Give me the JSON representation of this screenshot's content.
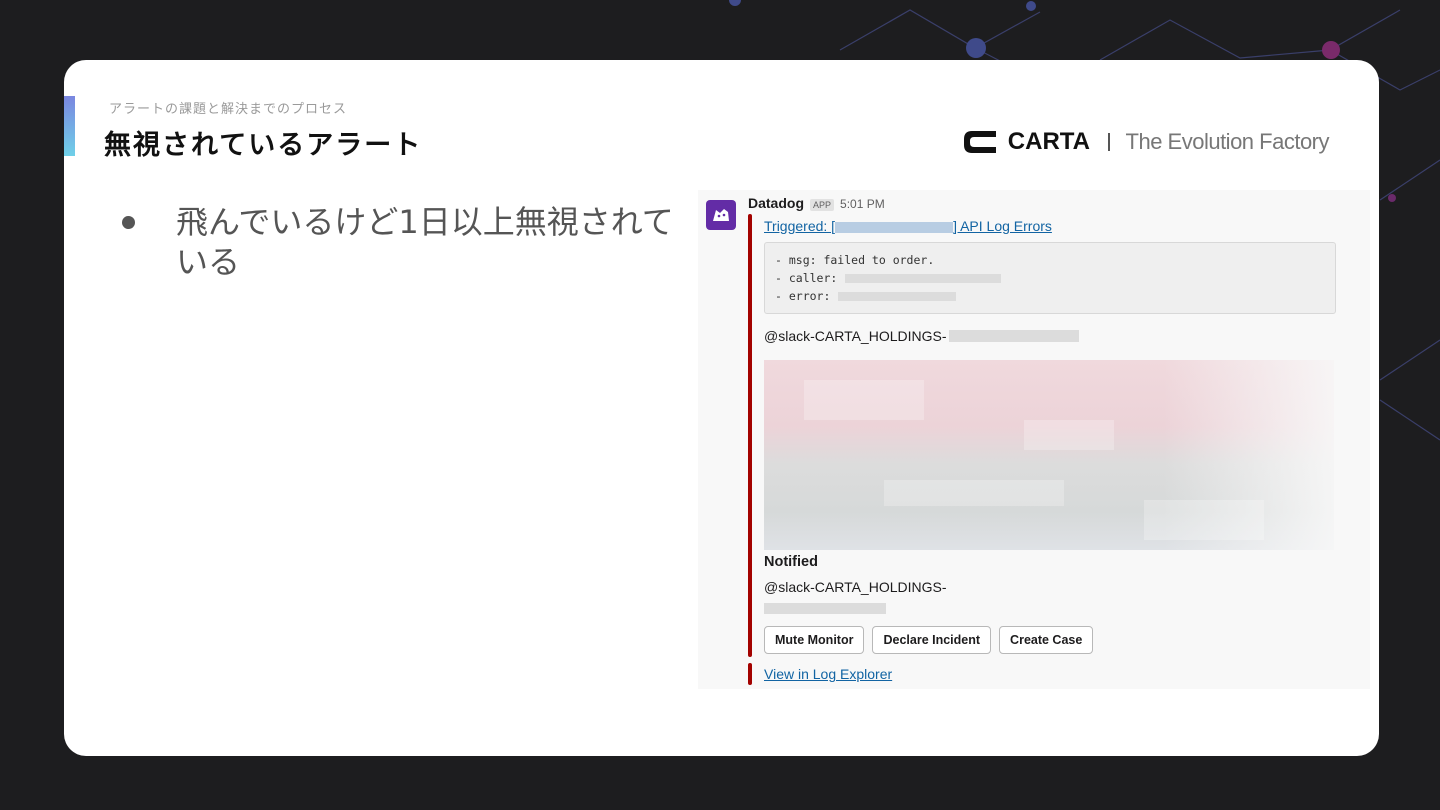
{
  "slide": {
    "eyebrow": "アラートの課題と解決までのプロセス",
    "title": "無視されているアラート",
    "brand_name": "CARTA",
    "brand_tagline": "The Evolution Factory",
    "bullets": [
      "飛んでいるけど1日以上無視されている"
    ],
    "accent_colors": {
      "bar_top": "#7a86e0",
      "bar_bottom": "#6fd0e8",
      "background": "#1d1d1f"
    }
  },
  "slack": {
    "sender": "Datadog",
    "app_badge": "APP",
    "time": "5:01 PM",
    "alert_prefix": "Triggered: [",
    "alert_suffix": "] API Log Errors",
    "code_lines": [
      "- msg: failed to order.",
      "- caller:",
      "- error:"
    ],
    "mention": "@slack-CARTA_HOLDINGS-",
    "notified_title": "Notified",
    "notified_mention": "@slack-CARTA_HOLDINGS-",
    "buttons": [
      "Mute Monitor",
      "Declare Incident",
      "Create Case"
    ],
    "view_link": "View in Log Explorer",
    "attachment_color": "#a30200",
    "link_color": "#1264a3"
  }
}
